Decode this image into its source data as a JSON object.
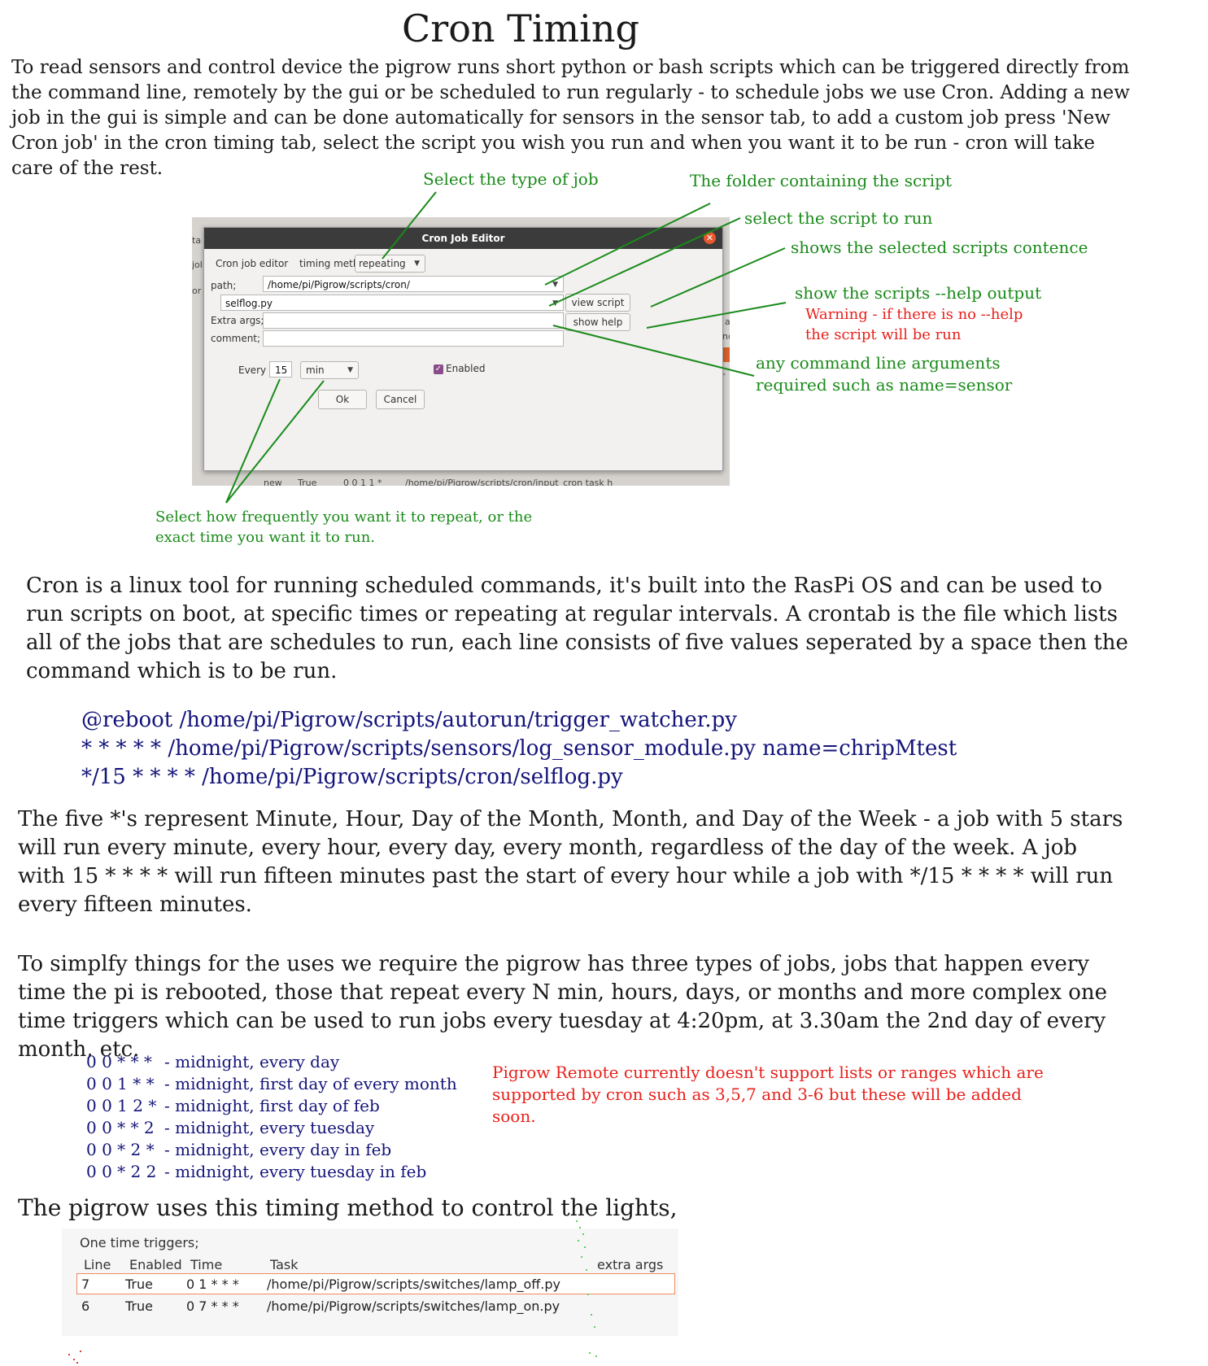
{
  "title": "Cron Timing",
  "intro": "To read sensors and control device the pigrow runs short python or bash scripts which can be triggered directly from the command line, remotely by the gui or be scheduled to run regularly - to schedule jobs we use Cron. Adding a new job in the gui is simple and can be done automatically  for  sensors in the sensor tab, to add a custom job press 'New Cron job' in the cron timing tab, select the script you wish you run and when you want it to be run - cron will take care of the rest.",
  "annotations": {
    "job_type": "Select the type of job",
    "folder": "The folder containing the script",
    "select_script": "select the script to run",
    "shows_contents": "shows the selected scripts contence",
    "show_help": "show the scripts --help output",
    "warning_line1": "Warning - if there is no --help",
    "warning_line2": "the script will be run",
    "args_line1": "any command line arguments",
    "args_line2": "required such as name=sensor",
    "frequency_line1": "Select how frequently you want it to repeat, or the",
    "frequency_line2": "exact time you want it to run."
  },
  "dialog": {
    "title": "Cron Job Editor",
    "close": "✕",
    "cron_job_editor_label": "Cron job editor",
    "timing_method_label": "timing meth",
    "timing_method_value": "repeating",
    "path_label": "path;",
    "path_value": "/home/pi/Pigrow/scripts/cron/",
    "script_value": "selflog.py",
    "view_script": "view script",
    "extra_args_label": "Extra args;",
    "show_help": "show help",
    "comment_label": "comment;",
    "every_label": "Every",
    "every_value": "15",
    "unit_value": "min",
    "enabled_label": "Enabled",
    "ok": "Ok",
    "cancel": "Cancel",
    "behind_fragments": {
      "left1": "ta",
      "left2": "jol",
      "left3": "or",
      "right1": "a",
      "right2": "nc",
      "right3": "-",
      "bottom_new": "new",
      "bottom_true": "True",
      "bottom_time": "0 0 1 1 *",
      "bottom_path": "/home/pi/Pigrow/scripts/cron/input_cron task h"
    }
  },
  "cron_intro": "Cron is a linux tool for running scheduled commands, it's built into the RasPi OS and can be used to run scripts on boot, at specific times or repeating at regular intervals. A crontab is the file which lists all of the jobs that are schedules to run, each line consists of five values seperated by a space then the command which is to be run.",
  "crontab_lines": [
    "@reboot /home/pi/Pigrow/scripts/autorun/trigger_watcher.py",
    "* * * * * /home/pi/Pigrow/scripts/sensors/log_sensor_module.py name=chripMtest",
    "*/15 * * * * /home/pi/Pigrow/scripts/cron/selflog.py"
  ],
  "stars_explanation": "The five *'s represent Minute, Hour, Day of the Month, Month, and Day of the Week - a job with 5 stars will run every minute, every hour, every day, every month, regardless of the day of the week. A job with 15 * * * * will run fifteen minutes past the start of every hour while a job with */15 * * * * will run every fifteen minutes.",
  "types_explanation": "To simplfy things for the uses we require the pigrow has three types of jobs, jobs that happen every time the pi is rebooted, those that repeat every N min, hours, days, or months and more complex one time triggers which can be used to run jobs every tuesday at 4:20pm, at 3.30am the 2nd day of every month, etc.",
  "examples": [
    {
      "expr": "0 0 * * *",
      "desc": "- midnight, every day"
    },
    {
      "expr": "0 0 1 * *",
      "desc": "- midnight, first day of every month"
    },
    {
      "expr": "0 0 1 2 *",
      "desc": "- midnight, first day of feb"
    },
    {
      "expr": "0 0 * * 2",
      "desc": "- midnight, every tuesday"
    },
    {
      "expr": "0 0 * 2 *",
      "desc": "- midnight, every day in feb"
    },
    {
      "expr": "0 0 * 2 2",
      "desc": "- midnight, every tuesday in feb"
    }
  ],
  "remote_note": "Pigrow Remote currently doesn't support lists or ranges which are supported by cron such as 3,5,7 and 3-6 but these will be added soon.",
  "lights_intro": "The pigrow uses this timing method to control the lights,",
  "triggers_table": {
    "heading": "One time triggers;",
    "columns": [
      "Line",
      "Enabled",
      "Time",
      "Task",
      "extra args"
    ],
    "rows": [
      {
        "line": "7",
        "enabled": "True",
        "time": "0 1 * * *",
        "task": "/home/pi/Pigrow/scripts/switches/lamp_off.py"
      },
      {
        "line": "6",
        "enabled": "True",
        "time": "0 7 * * *",
        "task": "/home/pi/Pigrow/scripts/switches/lamp_on.py"
      }
    ]
  },
  "colors": {
    "annotation": "#1a8a1a",
    "warning": "#e8201a",
    "code": "#13137a",
    "selected_row_border": "#f08a5d"
  }
}
